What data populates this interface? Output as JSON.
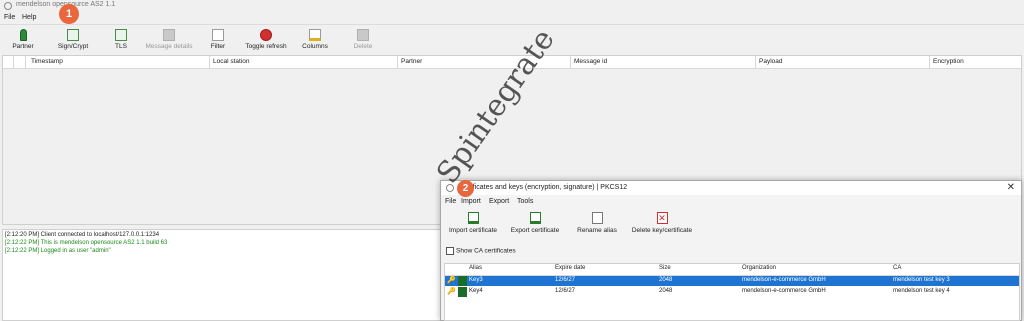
{
  "window": {
    "title": "mendelson opensource AS2 1.1"
  },
  "menu": {
    "items": [
      "File",
      "Help"
    ]
  },
  "toolbar": {
    "buttons": [
      {
        "label": "Partner",
        "icon": "partner-icon"
      },
      {
        "label": "Sign/Crypt",
        "icon": "certificate-icon"
      },
      {
        "label": "TLS",
        "icon": "tls-icon"
      },
      {
        "label": "Message details",
        "icon": "message-details-icon",
        "disabled": true
      },
      {
        "label": "Filter",
        "icon": "filter-icon"
      },
      {
        "label": "Toggle refresh",
        "icon": "stop-refresh-icon"
      },
      {
        "label": "Columns",
        "icon": "columns-icon"
      },
      {
        "label": "Delete",
        "icon": "delete-icon",
        "disabled": true
      }
    ]
  },
  "main_table": {
    "columns": [
      "Timestamp",
      "Local station",
      "Partner",
      "Message id",
      "Payload",
      "Encryption"
    ]
  },
  "log": {
    "lines": [
      {
        "text": "[2:12:20 PM] Client connected to localhost/127.0.0.1:1234",
        "color": "#222222"
      },
      {
        "text": "[2:12:22 PM] This is mendelson opensource AS2 1.1 build 63",
        "color": "#1a8a1a"
      },
      {
        "text": "[2:12:22 PM] Logged in as user \"admin\"",
        "color": "#1a8a1a"
      }
    ]
  },
  "annotations": {
    "step1": "1",
    "step2": "2"
  },
  "watermark": "Spintegrate",
  "dialog": {
    "title": "Certificates and keys (encryption, signature) | PKCS12",
    "menu": [
      "File",
      "Import",
      "Export",
      "Tools"
    ],
    "toolbar": [
      {
        "label": "Import certificate",
        "icon": "import-icon"
      },
      {
        "label": "Export certificate",
        "icon": "export-icon"
      },
      {
        "label": "Rename alias",
        "icon": "rename-icon"
      },
      {
        "label": "Delete key/certificate",
        "icon": "delete-x-icon"
      }
    ],
    "show_ca_label": "Show CA certificates",
    "table": {
      "columns": [
        "Alias",
        "Expire date",
        "Size",
        "Organization",
        "CA"
      ],
      "rows": [
        {
          "alias": "Key3",
          "expire": "12/6/27",
          "size": "2048",
          "organization": "mendelson-e-commerce GmbH",
          "ca": "mendelson test key 3",
          "selected": true
        },
        {
          "alias": "Key4",
          "expire": "12/6/27",
          "size": "2048",
          "organization": "mendelson-e-commerce GmbH",
          "ca": "mendelson test key 4",
          "selected": false
        }
      ]
    }
  }
}
